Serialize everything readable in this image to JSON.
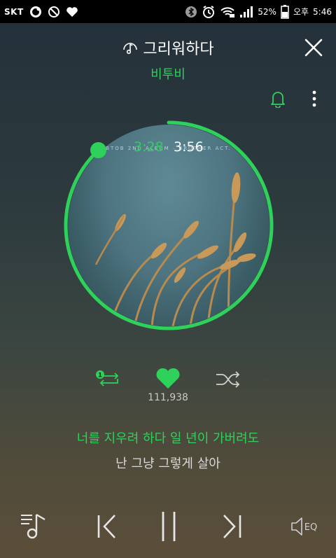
{
  "status_bar": {
    "carrier": "SKT",
    "battery": "52%",
    "ampm": "오후",
    "time": "5:46"
  },
  "player": {
    "song_title": "그리워하다",
    "artist": "비투비",
    "album_caption": "BTOB 2ND ALBUM · BROTHER ACT.",
    "elapsed": "3:28",
    "total": "3:56",
    "progress": 0.88,
    "like_count": "111,938",
    "repeat_badge": "1"
  },
  "lyrics": {
    "current": "너를 지우려 하다 일 년이 가버려도",
    "next": "난 그냥 그렇게 살아"
  },
  "controls": {
    "eq_label": "EQ"
  },
  "colors": {
    "accent": "#2ed15a",
    "background_top": "#23303a",
    "background_bottom": "#5b4e39"
  },
  "icons": [
    "music-note-icon",
    "close-icon",
    "bell-icon",
    "more-icon",
    "repeat-one-icon",
    "heart-icon",
    "shuffle-icon",
    "playlist-icon",
    "previous-icon",
    "pause-icon",
    "next-icon",
    "eq-icon"
  ]
}
